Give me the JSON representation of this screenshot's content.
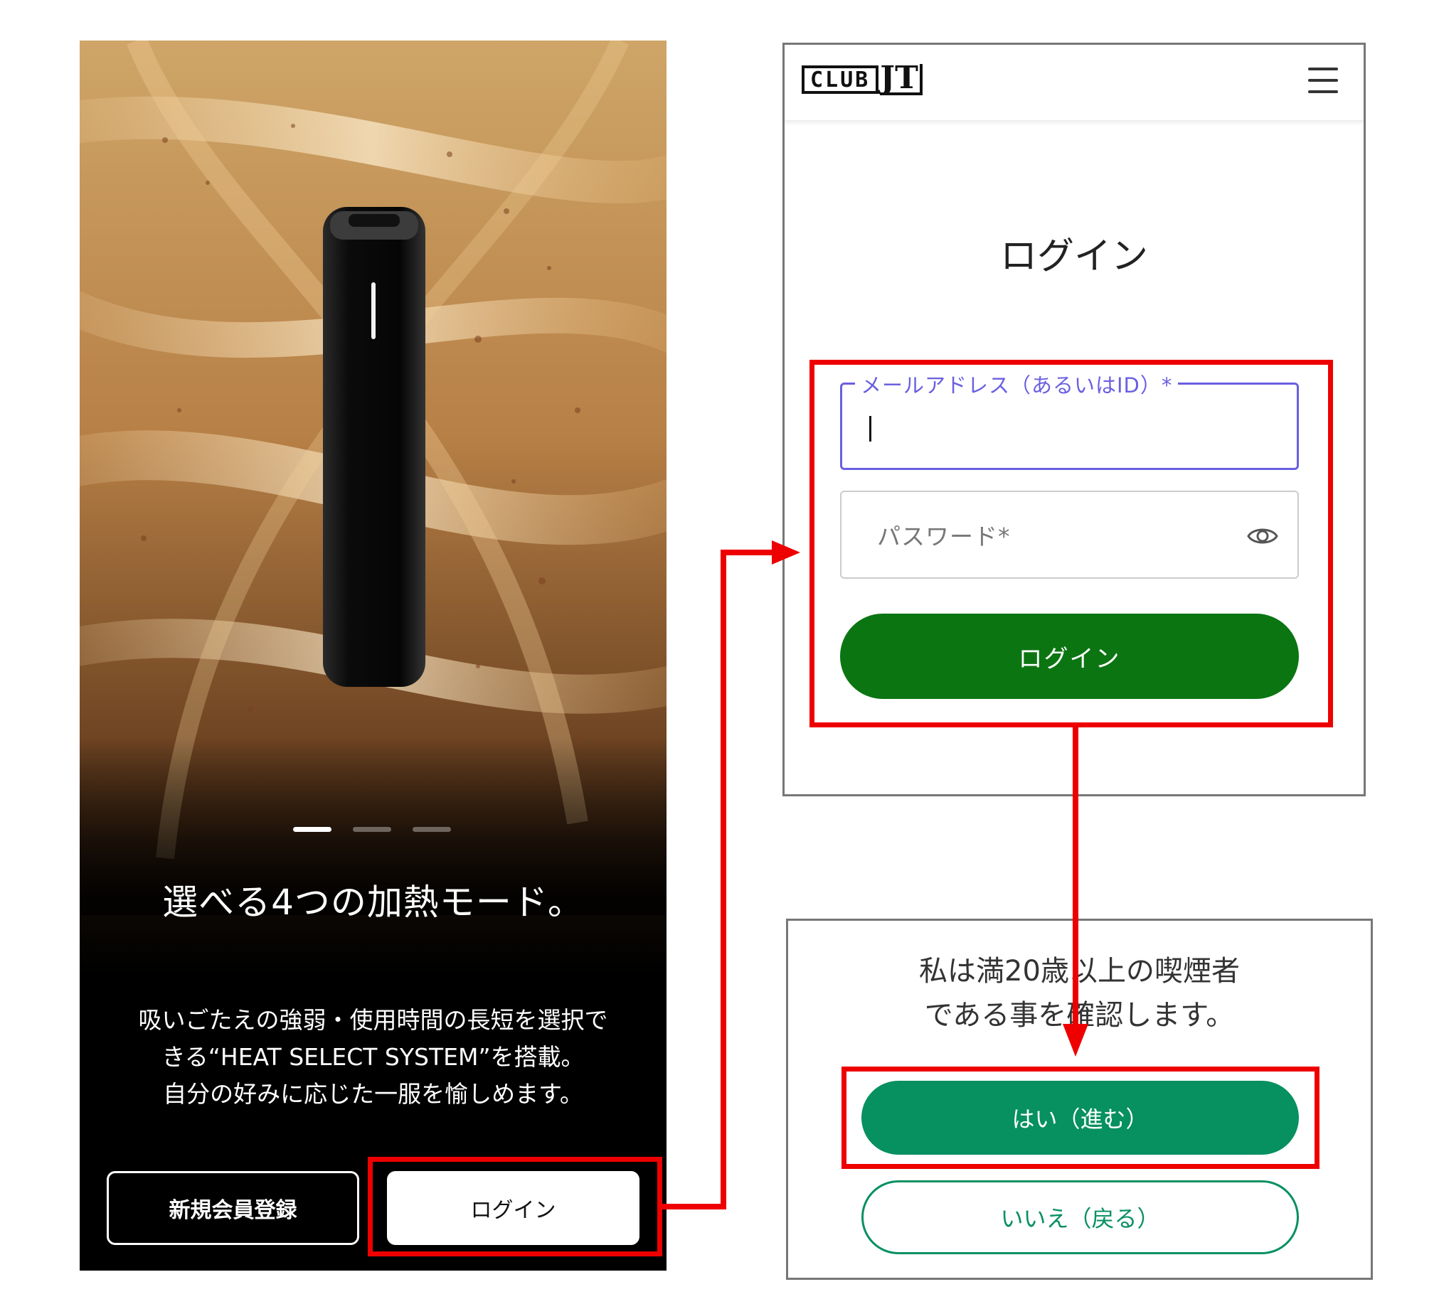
{
  "left_screen": {
    "slide_title": "選べる4つの加熱モード。",
    "description_lines": [
      "吸いごたえの強弱・使用時間の長短を選択で",
      "きる“HEAT SELECT SYSTEM”を搭載。",
      "自分の好みに応じた一服を愉しめます。"
    ],
    "register_label": "新規会員登録",
    "login_label": "ログイン",
    "carousel": {
      "count": 3,
      "active_index": 0
    }
  },
  "login_screen": {
    "logo_club": "CLUB",
    "logo_jt": "JT",
    "title": "ログイン",
    "email_label": "メールアドレス（あるいはID）*",
    "password_placeholder": "パスワード*",
    "login_button": "ログイン"
  },
  "confirm_screen": {
    "message_lines": [
      "私は満20歳以上の喫煙者",
      "である事を確認します。"
    ],
    "yes_label": "はい（進む）",
    "no_label": "いいえ（戻る）"
  },
  "colors": {
    "highlight_red": "#ee0000",
    "login_green": "#0b7512",
    "confirm_green": "#079060",
    "focus_purple": "#6a5fe0"
  },
  "icons": [
    "hamburger-menu-icon",
    "eye-icon",
    "arrow-icon"
  ]
}
